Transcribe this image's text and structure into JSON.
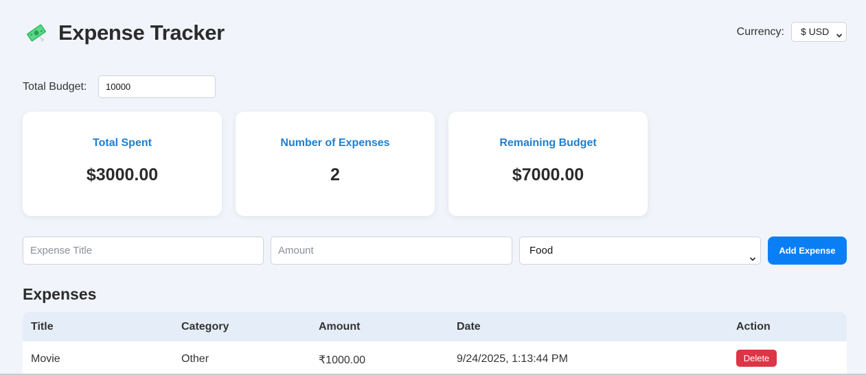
{
  "header": {
    "title": "Expense Tracker",
    "logo_icon": "money-icon",
    "currency_label": "Currency:",
    "currency_value": "$ USD"
  },
  "budget": {
    "label": "Total Budget:",
    "value": "10000"
  },
  "stats": [
    {
      "label": "Total Spent",
      "value": "$3000.00"
    },
    {
      "label": "Number of Expenses",
      "value": "2"
    },
    {
      "label": "Remaining Budget",
      "value": "$7000.00"
    }
  ],
  "form": {
    "title_placeholder": "Expense Title",
    "amount_placeholder": "Amount",
    "category_value": "Food",
    "add_label": "Add Expense"
  },
  "expenses": {
    "section_title": "Expenses",
    "columns": [
      "Title",
      "Category",
      "Amount",
      "Date",
      "Action"
    ],
    "rows": [
      {
        "title": "Movie",
        "category": "Other",
        "amount": "₹1000.00",
        "date": "9/24/2025, 1:13:44 PM",
        "action": "Delete"
      }
    ]
  },
  "colors": {
    "accent": "#0a7ff5",
    "card_label": "#1e7ed1",
    "delete": "#dc3545",
    "background": "#f1f4fb",
    "table_header": "#e5eef8"
  }
}
